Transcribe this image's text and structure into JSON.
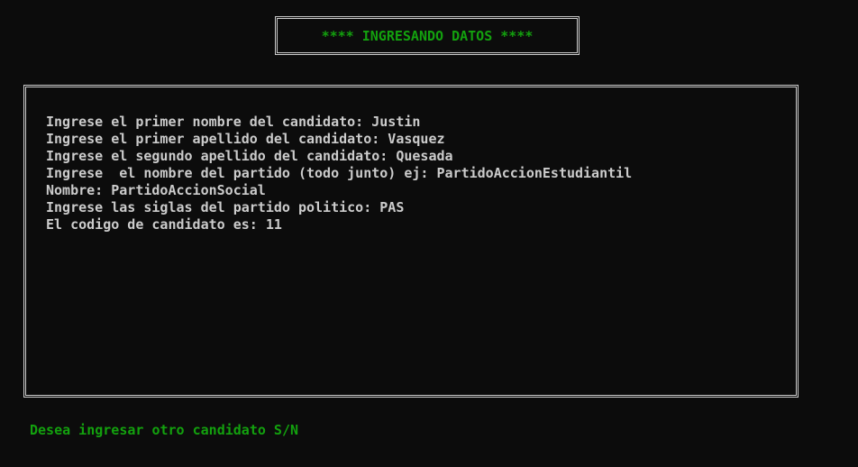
{
  "title": "**** INGRESANDO DATOS ****",
  "lines": [
    "Ingrese el primer nombre del candidato: Justin",
    "Ingrese el primer apellido del candidato: Vasquez",
    "Ingrese el segundo apellido del candidato: Quesada",
    "Ingrese  el nombre del partido (todo junto) ej: PartidoAccionEstudiantil",
    "Nombre: PartidoAccionSocial",
    "Ingrese las siglas del partido politico: PAS",
    "El codigo de candidato es: 11"
  ],
  "prompt": "Desea ingresar otro candidato S/N",
  "colors": {
    "background": "#0c0c0c",
    "text": "#cccccc",
    "accent_green": "#13a10e",
    "border": "#cccccc"
  }
}
